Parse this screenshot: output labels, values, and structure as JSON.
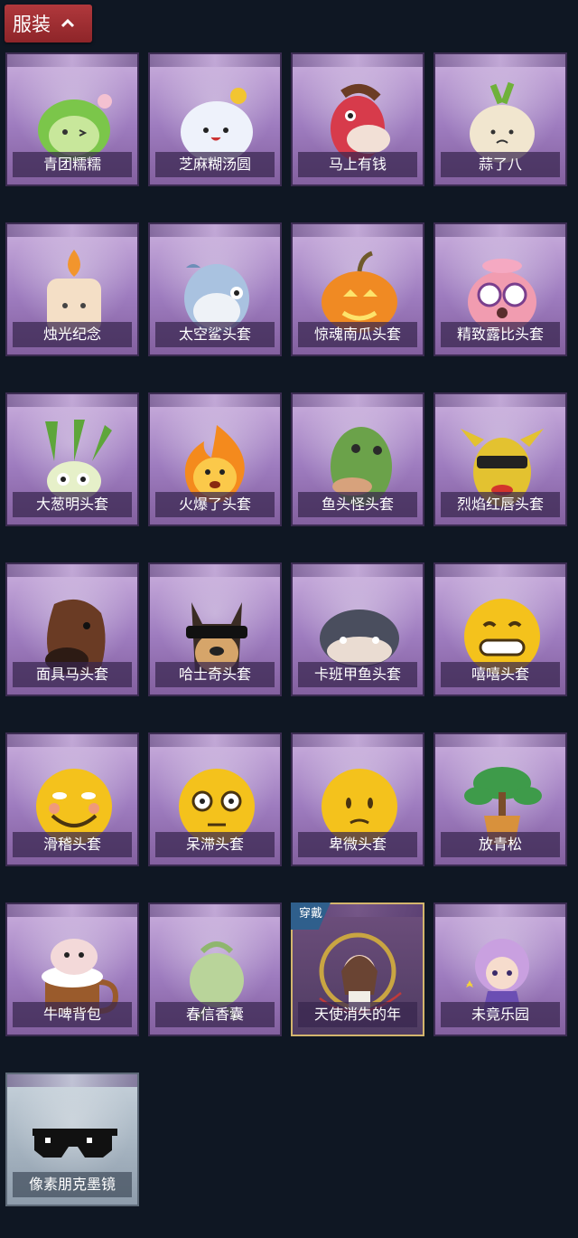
{
  "header": {
    "title": "服装"
  },
  "colors": {
    "accent": "#a0303a",
    "background": "#0f1723",
    "card": "#a384c2"
  },
  "items": [
    {
      "label": "青团糯糯",
      "icon": "green-dumpling-icon"
    },
    {
      "label": "芝麻糊汤圆",
      "icon": "white-dumpling-icon"
    },
    {
      "label": "马上有钱",
      "icon": "red-horse-icon"
    },
    {
      "label": "蒜了八",
      "icon": "garlic-icon"
    },
    {
      "label": "烛光纪念",
      "icon": "candle-icon"
    },
    {
      "label": "太空鲨头套",
      "icon": "shark-icon"
    },
    {
      "label": "惊魂南瓜头套",
      "icon": "pumpkin-icon"
    },
    {
      "label": "精致露比头套",
      "icon": "ruby-beaver-icon"
    },
    {
      "label": "大葱明头套",
      "icon": "scallion-icon"
    },
    {
      "label": "火爆了头套",
      "icon": "fire-icon"
    },
    {
      "label": "鱼头怪头套",
      "icon": "fish-head-icon"
    },
    {
      "label": "烈焰红唇头套",
      "icon": "yellow-mask-icon"
    },
    {
      "label": "面具马头套",
      "icon": "horse-mask-icon"
    },
    {
      "label": "哈士奇头套",
      "icon": "husky-icon"
    },
    {
      "label": "卡班甲鱼头套",
      "icon": "turtle-icon"
    },
    {
      "label": "嘻嘻头套",
      "icon": "grin-emoji-icon"
    },
    {
      "label": "滑稽头套",
      "icon": "funny-emoji-icon"
    },
    {
      "label": "呆滞头套",
      "icon": "stunned-emoji-icon"
    },
    {
      "label": "卑微头套",
      "icon": "humble-emoji-icon"
    },
    {
      "label": "放青松",
      "icon": "bonsai-icon"
    },
    {
      "label": "牛啤背包",
      "icon": "cow-beer-icon"
    },
    {
      "label": "春信香囊",
      "icon": "sachet-icon"
    },
    {
      "label": "天使消失的年",
      "icon": "angel-girl-icon",
      "badge": "穿戴",
      "worn": true
    },
    {
      "label": "未竟乐园",
      "icon": "fairy-girl-icon"
    },
    {
      "label": "像素朋克墨镜",
      "icon": "pixel-sunglasses-icon",
      "style": "gray"
    }
  ]
}
